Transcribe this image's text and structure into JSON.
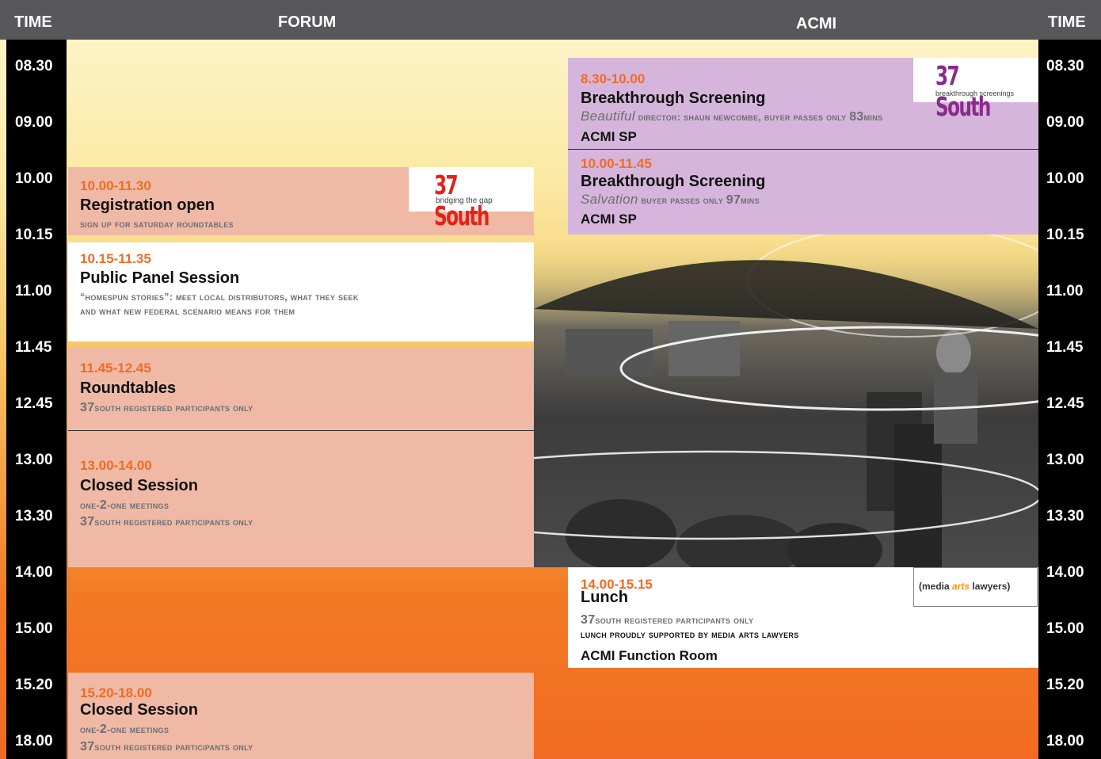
{
  "header": {
    "time_left": "TIME",
    "forum": "FORUM",
    "acmi": "ACMI",
    "time_right": "TIME"
  },
  "times": [
    "08.30",
    "09.00",
    "10.00",
    "10.15",
    "11.00",
    "11.45",
    "12.45",
    "13.00",
    "13.30",
    "14.00",
    "15.00",
    "15.20",
    "18.00"
  ],
  "forum": {
    "registration": {
      "time": "10.00-11.30",
      "title": "Registration open",
      "note": "SIGN UP FOR SATURDAY ROUNDTABLES",
      "logo_text": "37 South",
      "logo_sub": "bridging the gap"
    },
    "panel": {
      "time": "10.15-11.35",
      "title": "Public Panel Session",
      "note_line1": "“HOMESPUN STORIES”: MEET LOCAL DISTRIBUTORS, WHAT THEY SEEK",
      "note_line2": "AND WHAT NEW FEDERAL SCENARIO MEANS FOR THEM"
    },
    "roundtables": {
      "time": "11.45-12.45",
      "title": "Roundtables",
      "note_num": "37",
      "note_rest": "SOUTH REGISTERED PARTICIPANTS ONLY"
    },
    "closed1": {
      "time": "13.00-14.00",
      "title": "Closed Session",
      "note1_a": "ONE-",
      "note1_num": "2",
      "note1_b": "-ONE MEETINGS",
      "note2_num": "37",
      "note2_rest": "SOUTH REGISTERED PARTICIPANTS ONLY"
    },
    "closed2": {
      "time": "15.20-18.00",
      "title": "Closed Session",
      "note1_a": "ONE-",
      "note1_num": "2",
      "note1_b": "-ONE MEETINGS",
      "note2_num": "37",
      "note2_rest": "SOUTH REGISTERED PARTICIPANTS ONLY"
    }
  },
  "acmi": {
    "screening1": {
      "time": "8.30-10.00",
      "title": "Breakthrough Screening",
      "film": "Beautiful",
      "details_a": "DIRECTOR: SHAUN NEWCOMBE, BUYER PASSES ONLY ",
      "mins": "83",
      "mins_label": "MINS",
      "venue": "ACMI SP",
      "logo_text": "37 South",
      "logo_sub": "breakthrough screenings"
    },
    "screening2": {
      "time": "10.00-11.45",
      "title": "Breakthrough Screening",
      "film": "Salvation",
      "details_a": "BUYER PASSES ONLY ",
      "mins": "97",
      "mins_label": "MINS",
      "venue": "ACMI SP"
    },
    "lunch": {
      "time": "14.00-15.15",
      "title": "Lunch",
      "note_num": "37",
      "note_rest": "SOUTH REGISTERED PARTICIPANTS ONLY",
      "support": "LUNCH PROUDLY SUPPORTED BY MEDIA ARTS LAWYERS",
      "venue": "ACMI Function Room",
      "sponsor_a": "(media ",
      "sponsor_b": "arts",
      "sponsor_c": " lawyers)"
    }
  },
  "colors": {
    "orange": "#f26b22",
    "salmon": "#efb9a6",
    "lilac": "#d5b5db",
    "header": "#58585a",
    "logo_red": "#e2231a",
    "logo_purple": "#8a2a8e"
  }
}
